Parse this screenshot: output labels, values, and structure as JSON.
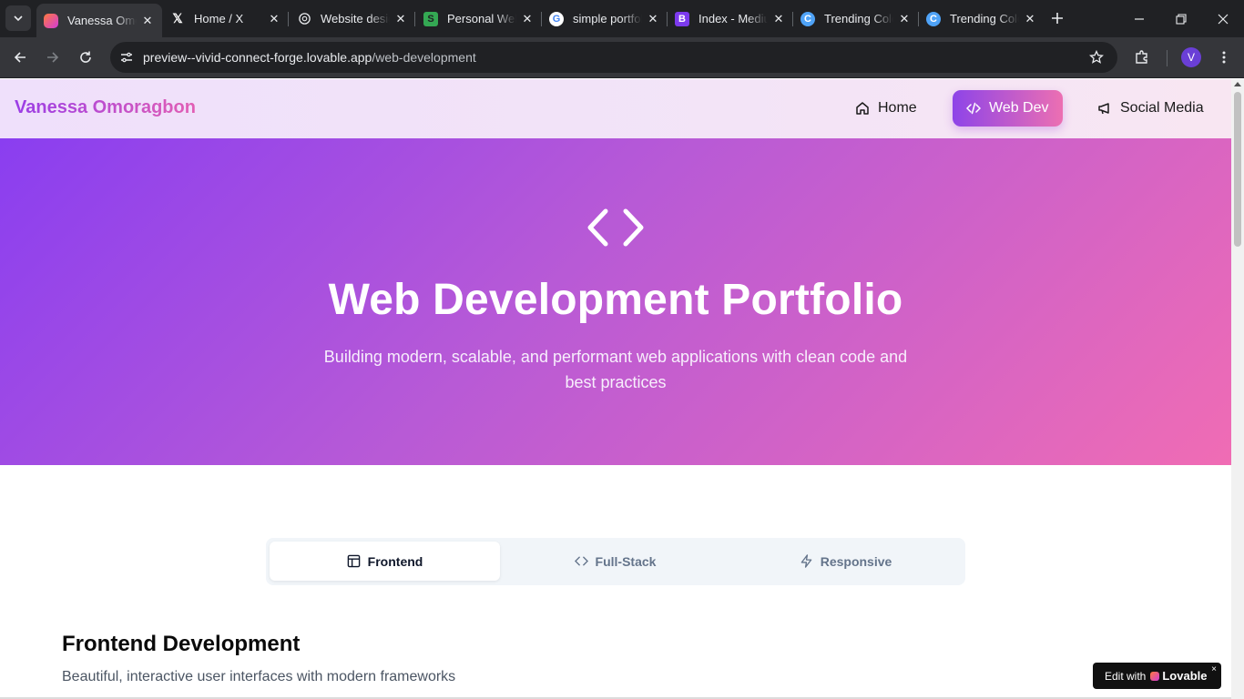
{
  "browser": {
    "tabs": [
      {
        "title": "Vanessa Omoragbon",
        "favicon": "lovable-heart-icon",
        "color": "#e9508b",
        "active": true
      },
      {
        "title": "Home / X",
        "favicon": "x-logo-icon",
        "color": "#ffffff",
        "active": false
      },
      {
        "title": "Website design",
        "favicon": "openai-icon",
        "color": "#ffffff",
        "active": false
      },
      {
        "title": "Personal Website",
        "favicon": "spreadsheet-icon",
        "color": "#34a853",
        "active": false
      },
      {
        "title": "simple portfolio",
        "favicon": "google-icon",
        "color": "#4285f4",
        "active": false
      },
      {
        "title": "Index - Medium",
        "favicon": "bootstrap-icon",
        "color": "#7c3aed",
        "active": false
      },
      {
        "title": "Trending Colors",
        "favicon": "coolors-icon",
        "color": "#4fa3f7",
        "active": false
      },
      {
        "title": "Trending Colors",
        "favicon": "coolors-icon",
        "color": "#4fa3f7",
        "active": false
      }
    ],
    "url_host": "preview--vivid-connect-forge.lovable.app",
    "url_path": "/web-development",
    "avatar_letter": "V"
  },
  "nav": {
    "brand": "Vanessa Omoragbon",
    "items": [
      {
        "label": "Home",
        "icon": "house-icon",
        "active": false
      },
      {
        "label": "Web Dev",
        "icon": "code-icon",
        "active": true
      },
      {
        "label": "Social Media",
        "icon": "megaphone-icon",
        "active": false
      }
    ]
  },
  "hero": {
    "icon": "code-chevrons-icon",
    "title": "Web Development Portfolio",
    "subtitle": "Building modern, scalable, and performant web applications with clean code and best practices"
  },
  "tabs": [
    {
      "label": "Frontend",
      "icon": "layout-icon",
      "active": true
    },
    {
      "label": "Full-Stack",
      "icon": "code-icon",
      "active": false
    },
    {
      "label": "Responsive",
      "icon": "zap-icon",
      "active": false
    }
  ],
  "section": {
    "title": "Frontend Development",
    "subtitle": "Beautiful, interactive user interfaces with modern frameworks"
  },
  "badge": {
    "prefix": "Edit with",
    "brand": "Lovable",
    "close": "×"
  },
  "colors": {
    "accent_purple": "#8a3ef0",
    "accent_pink": "#f06cb4"
  }
}
